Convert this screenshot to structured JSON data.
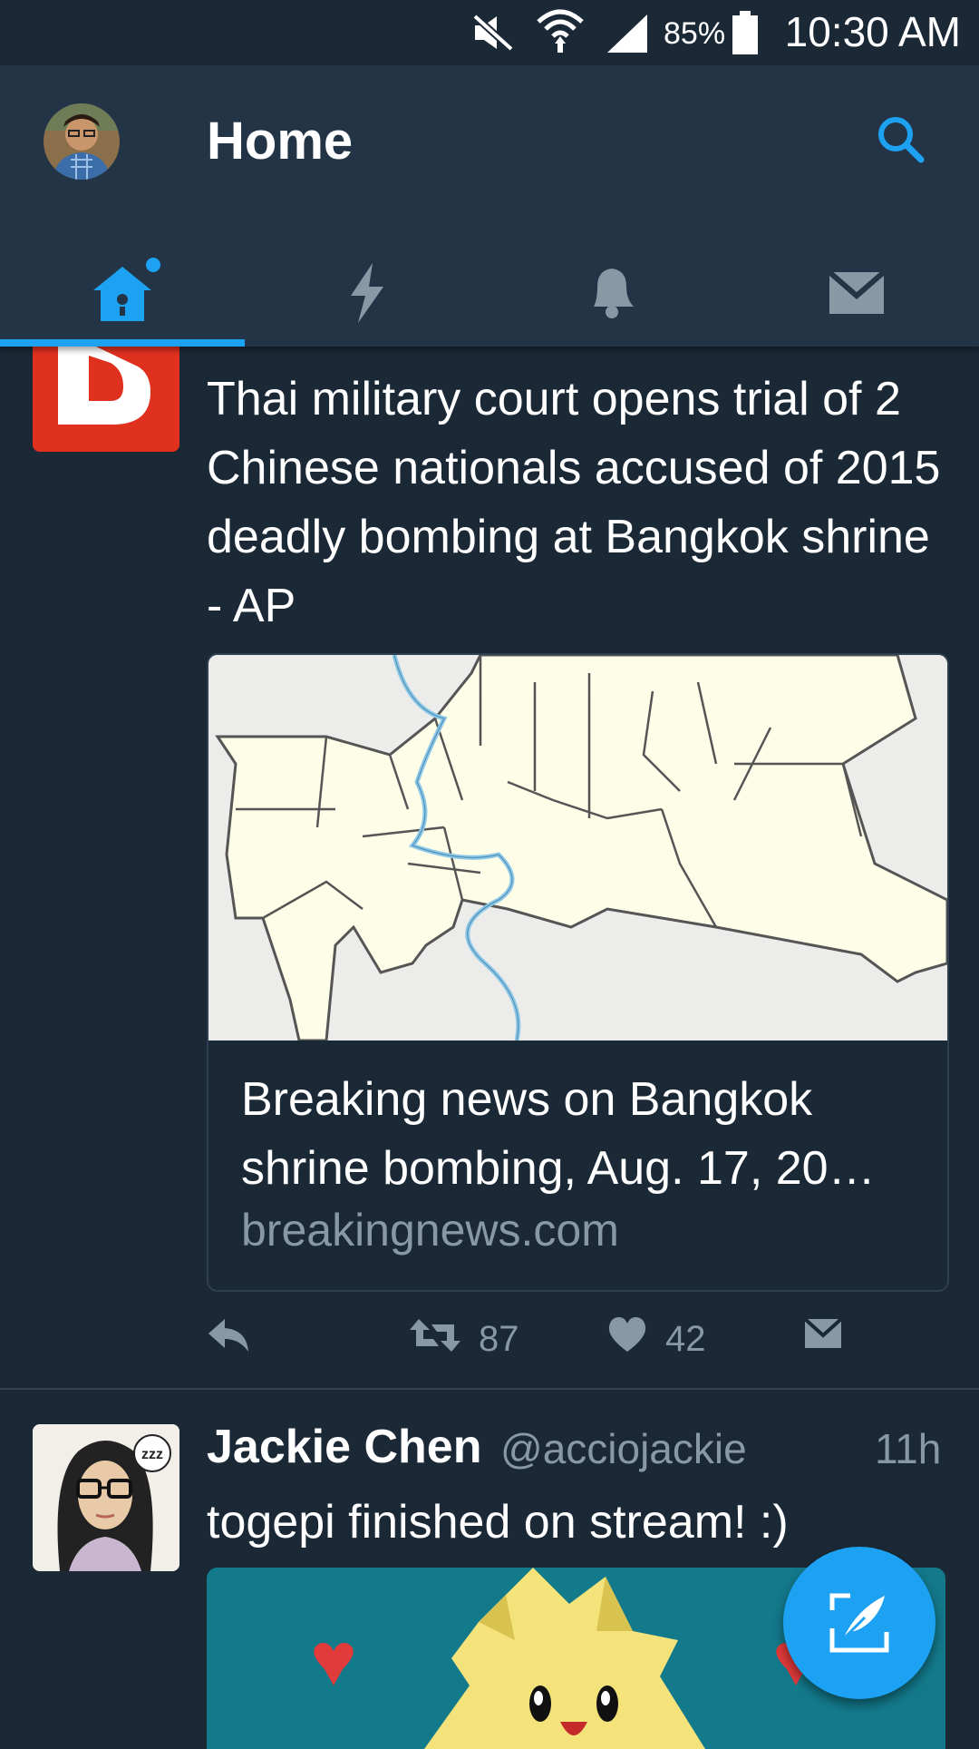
{
  "status_bar": {
    "battery_percent": "85%",
    "time": "10:30 AM"
  },
  "header": {
    "title": "Home",
    "tabs": [
      {
        "name": "home",
        "active": true
      },
      {
        "name": "moments",
        "active": false
      },
      {
        "name": "notifications",
        "active": false
      },
      {
        "name": "messages",
        "active": false
      }
    ]
  },
  "tweets": [
    {
      "text": "Thai military court opens trial of 2 Chinese nationals accused of 2015 deadly bombing at Bangkok shrine - AP",
      "card": {
        "title": "Breaking news on Bangkok shrine bombing, Aug. 17, 20…",
        "domain": "breakingnews.com"
      },
      "retweets": "87",
      "likes": "42"
    },
    {
      "name": "Jackie Chen",
      "handle": "@acciojackie",
      "time": "11h",
      "text": "togepi finished on stream! :)"
    }
  ],
  "colors": {
    "background": "#1b2836",
    "header": "#243447",
    "accent": "#1da1f2",
    "muted": "#8899a6"
  }
}
